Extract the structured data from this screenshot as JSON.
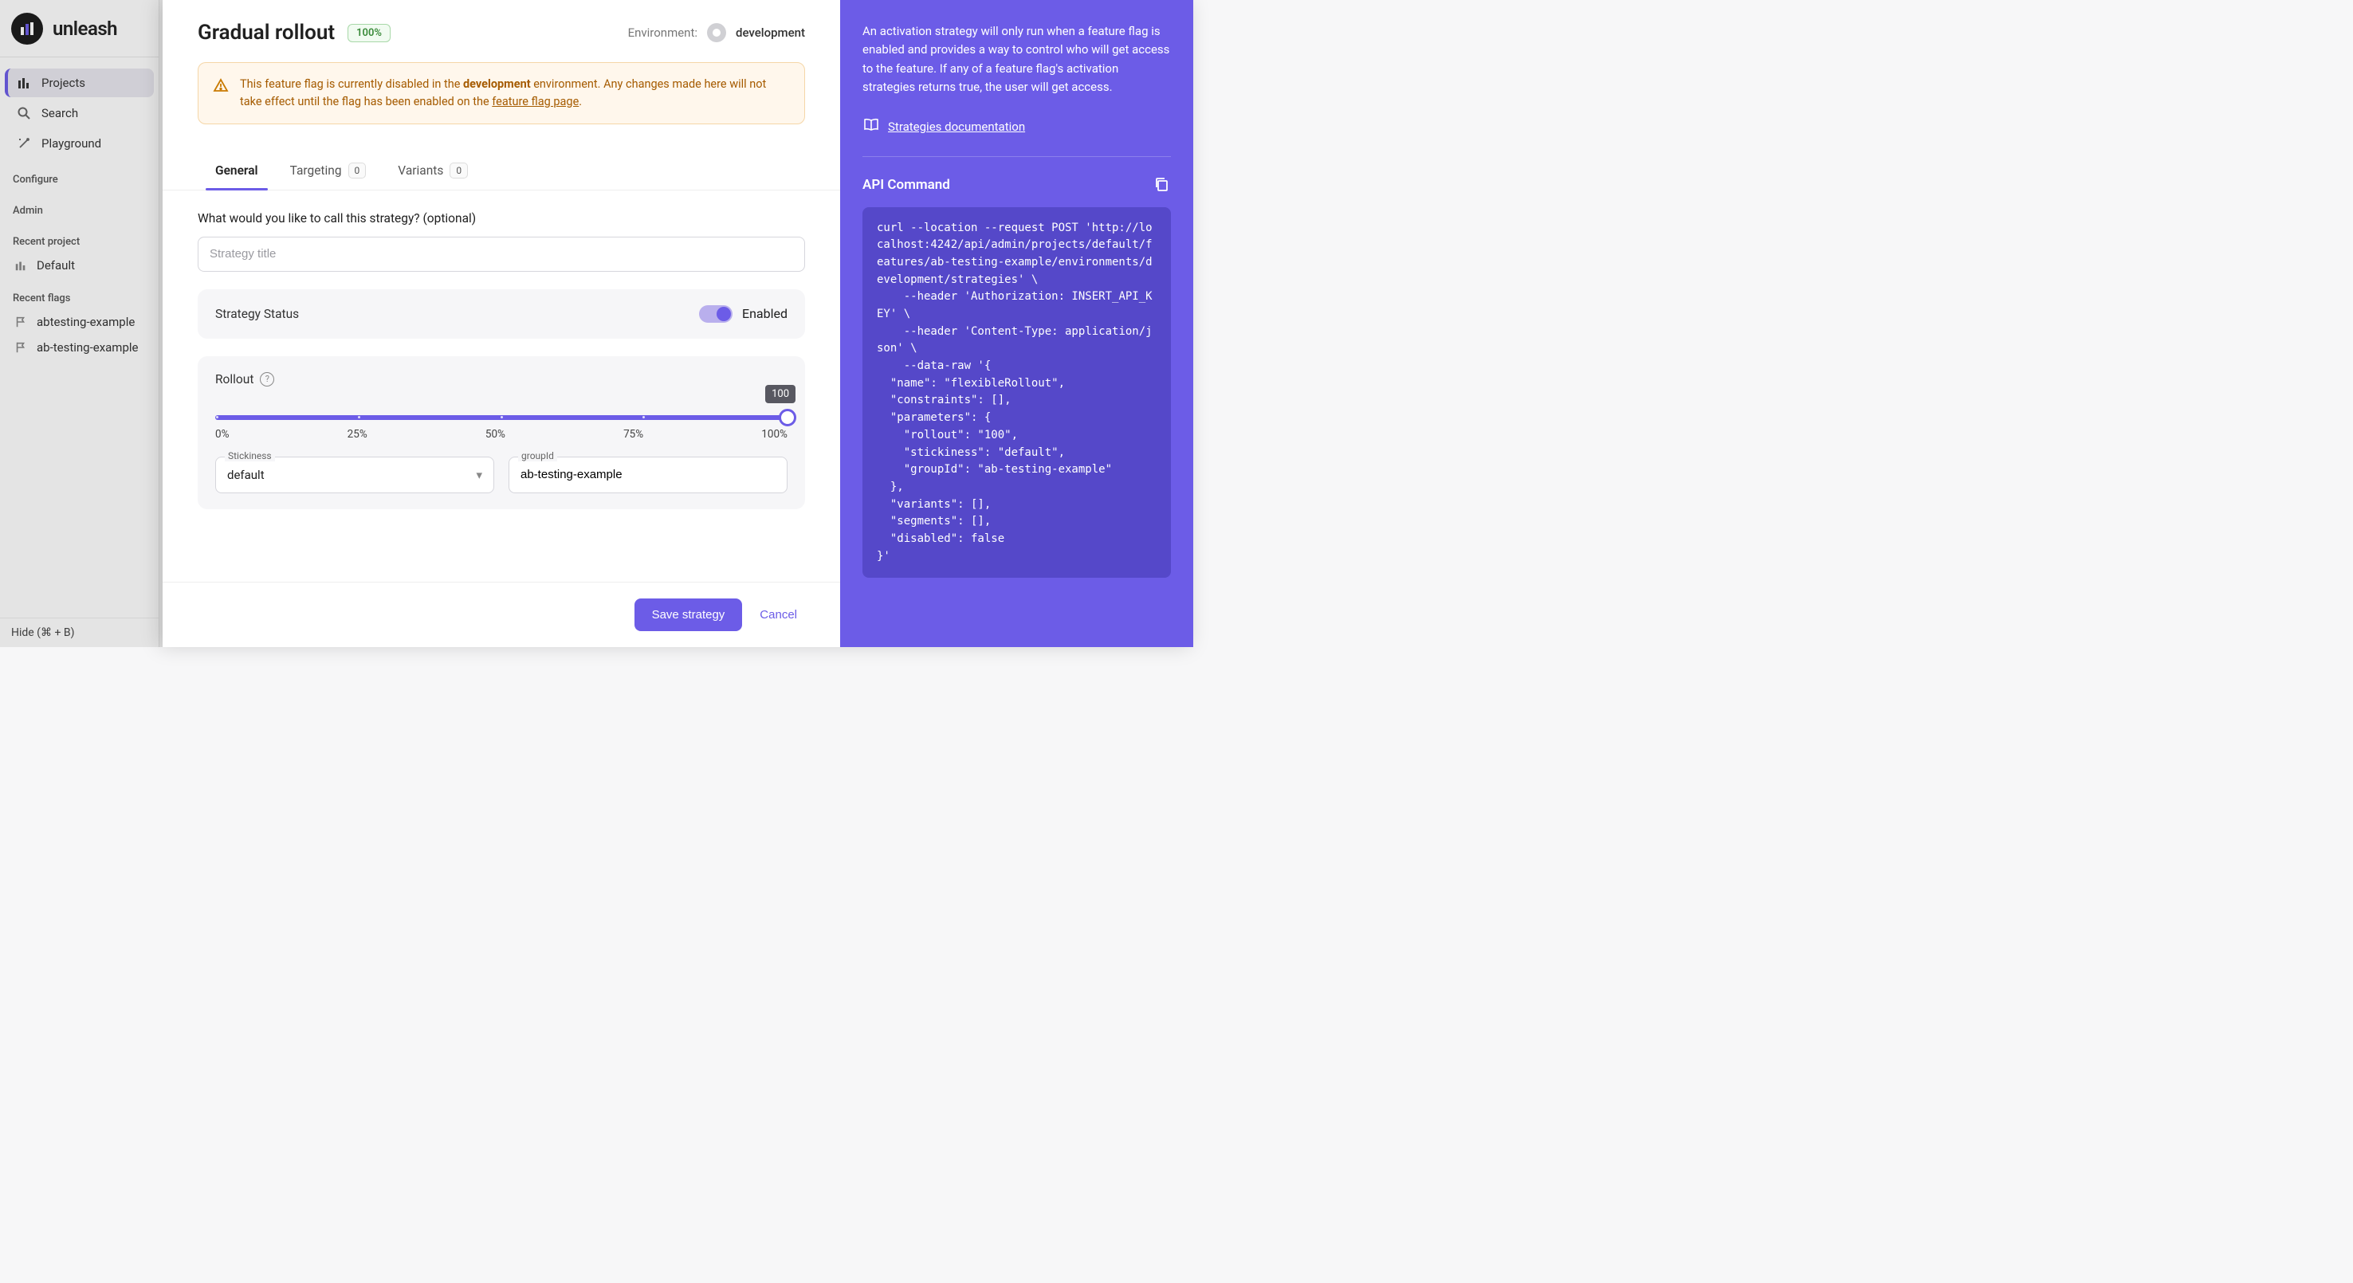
{
  "app": {
    "logo_text": "unleash"
  },
  "sidebar": {
    "nav": [
      {
        "label": "Projects",
        "icon": "bars-icon",
        "active": true
      },
      {
        "label": "Search",
        "icon": "search-icon",
        "active": false
      },
      {
        "label": "Playground",
        "icon": "wand-icon",
        "active": false
      }
    ],
    "sections": {
      "configure": "Configure",
      "admin": "Admin",
      "recent_project": "Recent project",
      "recent_flags": "Recent flags"
    },
    "recent_project": {
      "label": "Default"
    },
    "recent_flags": [
      {
        "label": "abtesting-example"
      },
      {
        "label": "ab-testing-example"
      }
    ],
    "footer": "Hide (⌘ + B)"
  },
  "modal": {
    "title": "Gradual rollout",
    "percent_badge": "100%",
    "environment_label": "Environment:",
    "environment": "development",
    "alert": {
      "pre": "This feature flag is currently disabled in the ",
      "env": "development",
      "mid": " environment. Any changes made here will not take effect until the flag has been enabled on the ",
      "link": "feature flag page",
      "post": "."
    },
    "tabs": {
      "general": "General",
      "targeting": {
        "label": "Targeting",
        "count": "0"
      },
      "variants": {
        "label": "Variants",
        "count": "0"
      }
    },
    "strategy_name_label": "What would you like to call this strategy? (optional)",
    "strategy_name_placeholder": "Strategy title",
    "status": {
      "label": "Strategy Status",
      "enabled_label": "Enabled"
    },
    "rollout": {
      "label": "Rollout",
      "value": "100",
      "marks": [
        "0%",
        "25%",
        "50%",
        "75%",
        "100%"
      ],
      "stickiness_label": "Stickiness",
      "stickiness_value": "default",
      "group_label": "groupId",
      "group_value": "ab-testing-example"
    },
    "buttons": {
      "save": "Save strategy",
      "cancel": "Cancel"
    }
  },
  "panel": {
    "description": "An activation strategy will only run when a feature flag is enabled and provides a way to control who will get access to the feature. If any of a feature flag's activation strategies returns true, the user will get access.",
    "doc_link": "Strategies documentation",
    "api_title": "API Command",
    "code": "curl --location --request POST 'http://localhost:4242/api/admin/projects/default/features/ab-testing-example/environments/development/strategies' \\\n    --header 'Authorization: INSERT_API_KEY' \\\n    --header 'Content-Type: application/json' \\\n    --data-raw '{\n  \"name\": \"flexibleRollout\",\n  \"constraints\": [],\n  \"parameters\": {\n    \"rollout\": \"100\",\n    \"stickiness\": \"default\",\n    \"groupId\": \"ab-testing-example\"\n  },\n  \"variants\": [],\n  \"segments\": [],\n  \"disabled\": false\n}'"
  }
}
